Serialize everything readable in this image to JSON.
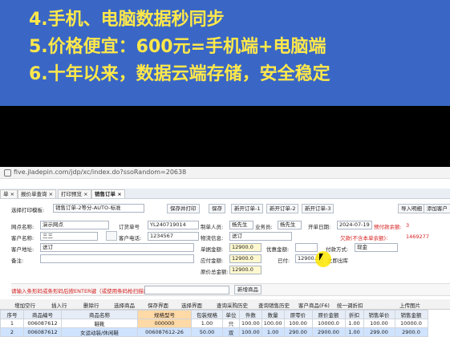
{
  "banner": {
    "lines": [
      "4.手机、电脑数据秒同步",
      "5.价格便宜：600元=手机端+电脑端",
      "6.十年以来，数据云端存储，安全稳定"
    ]
  },
  "browser": {
    "url": "five.jladepin.com/jdp/xc/index.do?ssoRandom=20638"
  },
  "tabs": [
    "单 ×",
    "报价单查询 ×",
    "打印预览 ×",
    "销售订单 ×"
  ],
  "toolbar": {
    "template_label": "选择打印模板:",
    "template_value": "销售订单-2等分-AUTO-标准",
    "save_print": "保存并打印",
    "save": "保存",
    "new1": "新开订单-1",
    "new2": "新开订单-2",
    "new3": "新开订单-3",
    "import_detail": "导入明细",
    "add_customer": "添加客户"
  },
  "form": {
    "point_label": "网点名称:",
    "point_value": "演示网点",
    "order_no_label": "订货单号",
    "order_no_value": "YL240719014",
    "maker_label": "制单人员:",
    "maker_value": "杨先生",
    "sales_label": "业务员:",
    "sales_value": "杨先生",
    "open_date_label": "开单日期:",
    "open_date_value": "2024-07-19",
    "pre_paid_label": "预付款余额:",
    "pre_paid_value": "3",
    "customer_label": "客户名称:",
    "customer_value": "三三",
    "phone_label": "客户电话:",
    "phone_value": "1234567",
    "logistics_label": "物流信息:",
    "logistics_value": "送订",
    "owed_label": "欠款(不含本单余额):",
    "owed_value": "1469277",
    "address_label": "客户地址:",
    "address_value": "送订",
    "discount_label": "优惠金额:",
    "pay_method_label": "付款方式:",
    "pay_method_value": "现金",
    "total_label": "单据金额:",
    "total_value": "12900.0",
    "receivable_label": "应付金额:",
    "receivable_value": "12900.0",
    "paid_label": "已付:",
    "paid_value": "12900.0",
    "instant_stock_label": "立即出库",
    "remark_label": "备注:",
    "cost_label": "原价总金额:",
    "cost_value": "12900.0"
  },
  "scan": {
    "hint": "请输入条形码或条形码后按ENTER键（或使用条码枪扫描商品）",
    "new_product": "新增商品"
  },
  "actions": [
    "增加空行",
    "插入行",
    "删除行",
    "选择商品",
    "保存界面",
    "选择界面",
    "查询采购历史",
    "查询销售历史",
    "客户商品(F6)",
    "统一调折扣",
    "上传图片"
  ],
  "grid": {
    "headers": [
      "序号",
      "商品编号",
      "商品名称",
      "规格型号",
      "包装规格",
      "单位",
      "件数",
      "数量",
      "原零价",
      "原价金额",
      "折扣",
      "销售单价",
      "销售金额"
    ],
    "rows": [
      [
        "1",
        "006087612",
        "鞋靴",
        "000000",
        "1.00",
        "只",
        "100.00",
        "100.00",
        "100.00",
        "10000.0",
        "1.00",
        "100.00",
        "10000.0"
      ],
      [
        "2",
        "006087612",
        "女运动装/休闲鞋",
        "006087612-26",
        "50.00",
        "双",
        "100.00",
        "1.00",
        "290.00",
        "2900.00",
        "1.00",
        "299.00",
        "2900.0"
      ]
    ]
  },
  "colors": {
    "banner_bg": "#3a67c6",
    "banner_text": "#ffe84a",
    "highlight_col": "#ffd9a6"
  }
}
